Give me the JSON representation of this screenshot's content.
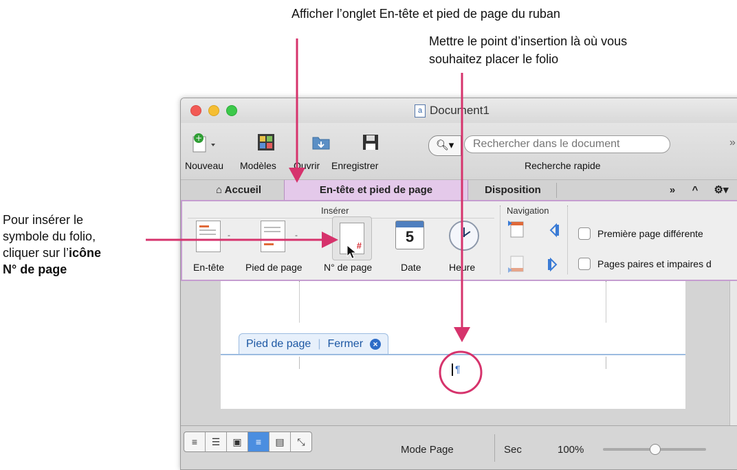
{
  "annotations": {
    "top_1": "Afficher l’onglet En-tête et pied de page du ruban",
    "top_2_line1": "Mettre le point d’insertion là où vous",
    "top_2_line2": "souhaitez placer le folio",
    "left_line1": "Pour insérer le",
    "left_line2": "symbole du folio,",
    "left_line3_prefix": "cliquer sur l’",
    "left_line3_bold": "icône",
    "left_line4": "N° de page"
  },
  "window": {
    "title": "Document1"
  },
  "toolbar": {
    "new_label": "Nouveau",
    "templates_label": "Modèles",
    "open_label": "Ouvrir",
    "save_label": "Enregistrer",
    "search_placeholder": "Rechercher dans le document",
    "quick_search_label": "Recherche rapide"
  },
  "tabs": {
    "home": "Accueil",
    "header_footer": "En-tête et pied de page",
    "layout": "Disposition"
  },
  "ribbon": {
    "group_insert": "Insérer",
    "group_navigation": "Navigation",
    "header_label": "En-tête",
    "footer_label": "Pied de page",
    "page_number_label": "N° de page",
    "date_label": "Date",
    "date_icon_text": "5",
    "time_label": "Heure",
    "first_page_diff": "Première page différente",
    "odd_even_pages": "Pages paires et impaires d"
  },
  "document": {
    "footer_tag": "Pied de page",
    "close_label": "Fermer",
    "paragraph_mark": "¶"
  },
  "status": {
    "mode": "Mode Page",
    "dry": "Sec",
    "zoom": "100%"
  },
  "colors": {
    "accent_pink": "#d6336c",
    "tab_active": "#e4c9ea",
    "selected_view": "#4b8ee0"
  }
}
